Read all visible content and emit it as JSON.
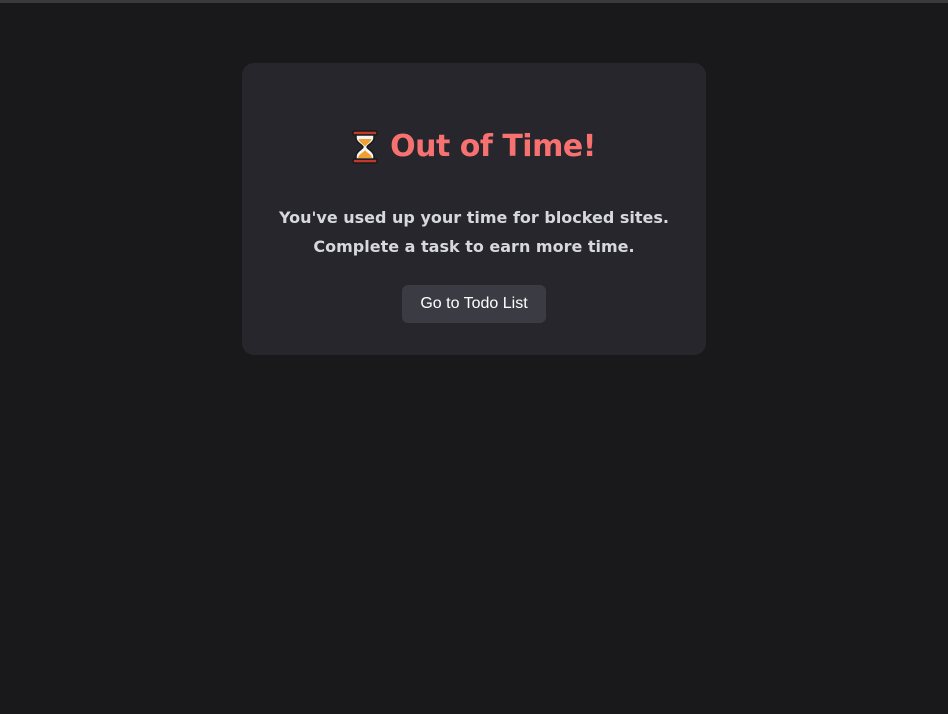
{
  "card": {
    "icon": "hourglass-icon",
    "title": "Out of Time!",
    "message_line1": "You've used up your time for blocked sites.",
    "message_line2": "Complete a task to earn more time.",
    "button_label": "Go to Todo List"
  },
  "colors": {
    "background": "#19191b",
    "card": "#26262c",
    "title": "#f87171",
    "message": "#d7d7de",
    "button": "#3b3b43",
    "button_text": "#ffffff"
  }
}
